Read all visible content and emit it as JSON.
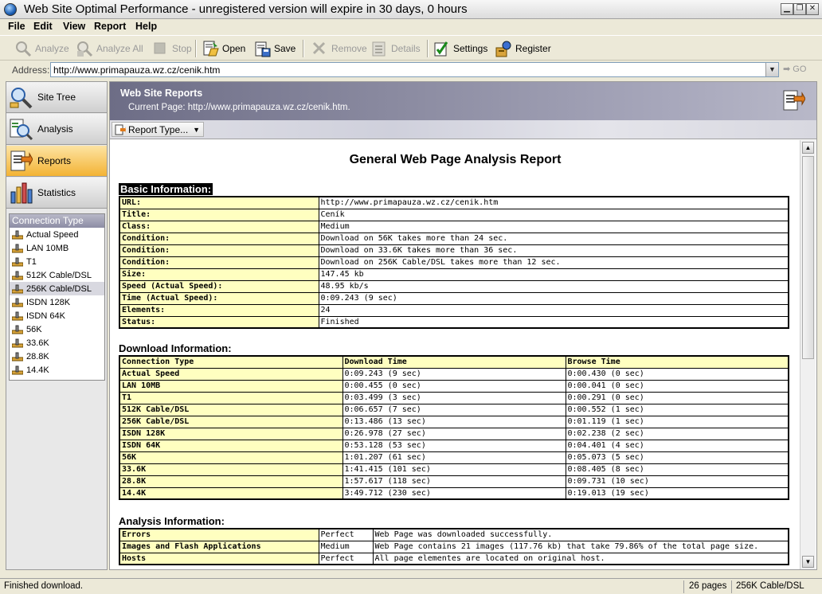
{
  "window": {
    "title": "Web Site Optimal Performance - unregistered version will expire in 30 days, 0 hours"
  },
  "menu": [
    "File",
    "Edit",
    "View",
    "Report",
    "Help"
  ],
  "toolbar": [
    {
      "label": "Analyze",
      "enabled": false
    },
    {
      "label": "Analyze All",
      "enabled": false
    },
    {
      "label": "Stop",
      "enabled": false
    },
    {
      "label": "Open",
      "enabled": true
    },
    {
      "label": "Save",
      "enabled": true
    },
    {
      "label": "Remove",
      "enabled": false
    },
    {
      "label": "Details",
      "enabled": false
    },
    {
      "label": "Settings",
      "enabled": true
    },
    {
      "label": "Register",
      "enabled": true
    }
  ],
  "address": {
    "label": "Address:",
    "value": "http://www.primapauza.wz.cz/cenik.htm",
    "go_label": "GO"
  },
  "sidebar": {
    "nav": [
      {
        "label": "Site Tree",
        "active": false
      },
      {
        "label": "Analysis",
        "active": false
      },
      {
        "label": "Reports",
        "active": true
      },
      {
        "label": "Statistics",
        "active": false
      }
    ],
    "connection_header": "Connection Type",
    "connections": [
      "Actual Speed",
      "LAN 10MB",
      "T1",
      "512K Cable/DSL",
      "256K Cable/DSL",
      "ISDN 128K",
      "ISDN 64K",
      "56K",
      "33.6K",
      "28.8K",
      "14.4K"
    ],
    "selected_connection": "256K Cable/DSL"
  },
  "banner": {
    "title": "Web Site Reports",
    "current_page": "Current Page: http://www.primapauza.wz.cz/cenik.htm."
  },
  "report_type_label": "Report Type...",
  "report": {
    "title": "General Web Page Analysis Report",
    "basic_heading": "Basic Information:",
    "basic": [
      [
        "URL:",
        "http://www.primapauza.wz.cz/cenik.htm"
      ],
      [
        "Title:",
        "Ceník"
      ],
      [
        "Class:",
        "Medium"
      ],
      [
        "Condition:",
        "Download on 56K takes more than 24 sec."
      ],
      [
        "Condition:",
        "Download on 33.6K takes more than 36 sec."
      ],
      [
        "Condition:",
        "Download on 256K Cable/DSL takes more than 12 sec."
      ],
      [
        "Size:",
        "147.45 kb"
      ],
      [
        "Speed (Actual Speed):",
        "48.95 kb/s"
      ],
      [
        "Time (Actual Speed):",
        "0:09.243 (9 sec)"
      ],
      [
        "Elements:",
        "24"
      ],
      [
        "Status:",
        "Finished"
      ]
    ],
    "download_heading": "Download Information:",
    "download_columns": [
      "Connection Type",
      "Download Time",
      "Browse Time"
    ],
    "download": [
      [
        "Actual Speed",
        "0:09.243 (9 sec)",
        "0:00.430 (0 sec)"
      ],
      [
        "LAN 10MB",
        "0:00.455 (0 sec)",
        "0:00.041 (0 sec)"
      ],
      [
        "T1",
        "0:03.499 (3 sec)",
        "0:00.291 (0 sec)"
      ],
      [
        "512K Cable/DSL",
        "0:06.657 (7 sec)",
        "0:00.552 (1 sec)"
      ],
      [
        "256K Cable/DSL",
        "0:13.486 (13 sec)",
        "0:01.119 (1 sec)"
      ],
      [
        "ISDN 128K",
        "0:26.978 (27 sec)",
        "0:02.238 (2 sec)"
      ],
      [
        "ISDN 64K",
        "0:53.128 (53 sec)",
        "0:04.401 (4 sec)"
      ],
      [
        "56K",
        "1:01.207 (61 sec)",
        "0:05.073 (5 sec)"
      ],
      [
        "33.6K",
        "1:41.415 (101 sec)",
        "0:08.405 (8 sec)"
      ],
      [
        "28.8K",
        "1:57.617 (118 sec)",
        "0:09.731 (10 sec)"
      ],
      [
        "14.4K",
        "3:49.712 (230 sec)",
        "0:19.013 (19 sec)"
      ]
    ],
    "analysis_heading": "Analysis Information:",
    "analysis": [
      [
        "Errors",
        "Perfect",
        "Web Page was downloaded successfully."
      ],
      [
        "Images and Flash Applications",
        "Medium",
        "Web Page contains 21 images (117.76 kb) that take 79.86% of the total page size."
      ],
      [
        "Hosts",
        "Perfect",
        "All page elementes are located on original host."
      ]
    ]
  },
  "status": {
    "message": "Finished download.",
    "pages": "26 pages",
    "connection": "256K Cable/DSL"
  }
}
